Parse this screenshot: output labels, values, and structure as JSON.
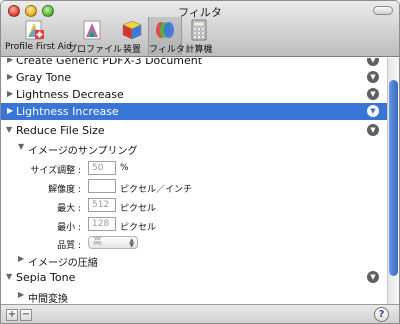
{
  "window": {
    "title": "フィルタ"
  },
  "toolbar": {
    "items": [
      {
        "label": "Profile First Aid",
        "icon": "profile-first-aid-icon"
      },
      {
        "label": "プロファイル",
        "icon": "profile-icon"
      },
      {
        "label": "装置",
        "icon": "device-icon"
      },
      {
        "label": "フィルタ",
        "icon": "filter-icon",
        "selected": true
      },
      {
        "label": "計算機",
        "icon": "calculator-icon"
      }
    ]
  },
  "list": {
    "rows": [
      {
        "label": "Create Generic PDFX-3 Document",
        "expanded": false
      },
      {
        "label": "Gray Tone",
        "expanded": false
      },
      {
        "label": "Lightness Decrease",
        "expanded": false
      },
      {
        "label": "Lightness Increase",
        "expanded": false,
        "selected": true
      },
      {
        "label": "Reduce File Size",
        "expanded": true
      },
      {
        "label": "Sepia Tone",
        "expanded": true
      }
    ],
    "reduce": {
      "sampling_label": "イメージのサンプリング",
      "fields": [
        {
          "label": "サイズ調整 :",
          "value": "50",
          "unit": "%"
        },
        {
          "label": "解像度 :",
          "value": "",
          "unit": "ピクセル／インチ"
        },
        {
          "label": "最大 :",
          "value": "512",
          "unit": "ピクセル"
        },
        {
          "label": "最小 :",
          "value": "128",
          "unit": "ピクセル"
        }
      ],
      "quality_label": "品質 :",
      "quality_value": "高",
      "compression_label": "イメージの圧縮"
    },
    "sepia": {
      "sub_label": "中間変換"
    },
    "row_action_glyph": "▼",
    "collapsed_glyph": "▶",
    "expanded_glyph": "▼"
  },
  "bottom": {
    "add": "+",
    "remove": "−",
    "help": "?"
  },
  "colors": {
    "selection": "#3875d7",
    "accent": "#4c7fd2"
  }
}
